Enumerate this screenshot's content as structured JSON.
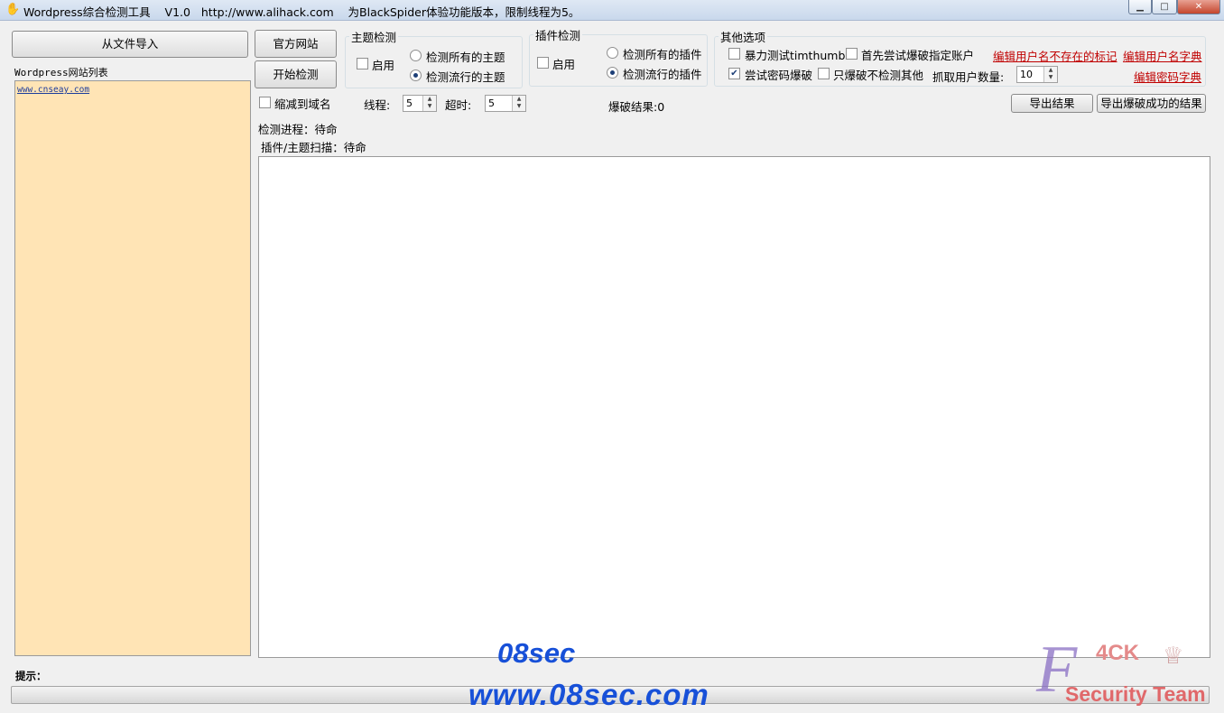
{
  "window": {
    "title": "Wordpress综合检测工具    V1.0   http://www.alihack.com    为BlackSpider体验功能版本，限制线程为5。",
    "minimize_label": "▁",
    "maximize_label": "□",
    "close_label": "✕"
  },
  "left": {
    "import_button": "从文件导入",
    "list_label": "Wordpress网站列表",
    "sites": [
      "www.cnseay.com"
    ]
  },
  "actions": {
    "official_site_button": "官方网站",
    "start_button": "开始检测"
  },
  "theme_group": {
    "title": "主题检测",
    "enable_label": "启用",
    "enable_checked": false,
    "radio_all": "检测所有的主题",
    "radio_popular": "检测流行的主题",
    "selected": "popular"
  },
  "plugin_group": {
    "title": "插件检测",
    "enable_label": "启用",
    "enable_checked": false,
    "radio_all": "检测所有的插件",
    "radio_popular": "检测流行的插件",
    "selected": "popular"
  },
  "other_group": {
    "title": "其他选项",
    "timthumb_label": "暴力测试timthumb",
    "timthumb_checked": false,
    "first_account_label": "首先尝试爆破指定账户",
    "first_account_checked": false,
    "try_password_label": "尝试密码爆破",
    "try_password_checked": true,
    "only_brute_label": "只爆破不检测其他",
    "only_brute_checked": false,
    "fetch_users_label": "抓取用户数量:",
    "fetch_users_value": "10",
    "edit_nonexist_link": "编辑用户名不存在的标记",
    "edit_username_dict_link": "编辑用户名字典",
    "edit_password_dict_link": "编辑密码字典"
  },
  "options": {
    "shrink_label": "缩减到域名",
    "shrink_checked": false,
    "threads_label": "线程:",
    "threads_value": "5",
    "timeout_label": "超时:",
    "timeout_value": "5",
    "brute_result": "爆破结果:0",
    "export_button": "导出结果",
    "export_success_button": "导出爆破成功的结果"
  },
  "status": {
    "progress": "检测进程：待命",
    "scan": "插件/主题扫描：待命",
    "hint_label": "提示："
  },
  "watermark": {
    "line1": "08sec",
    "line2": "www.08sec.com",
    "team_top": "4CK",
    "team_letter": "F",
    "team_bottom": "Security Team"
  },
  "colors": {
    "list_bg": "#ffe4b5",
    "link_red": "#c00000",
    "watermark_blue": "#1750d8"
  }
}
